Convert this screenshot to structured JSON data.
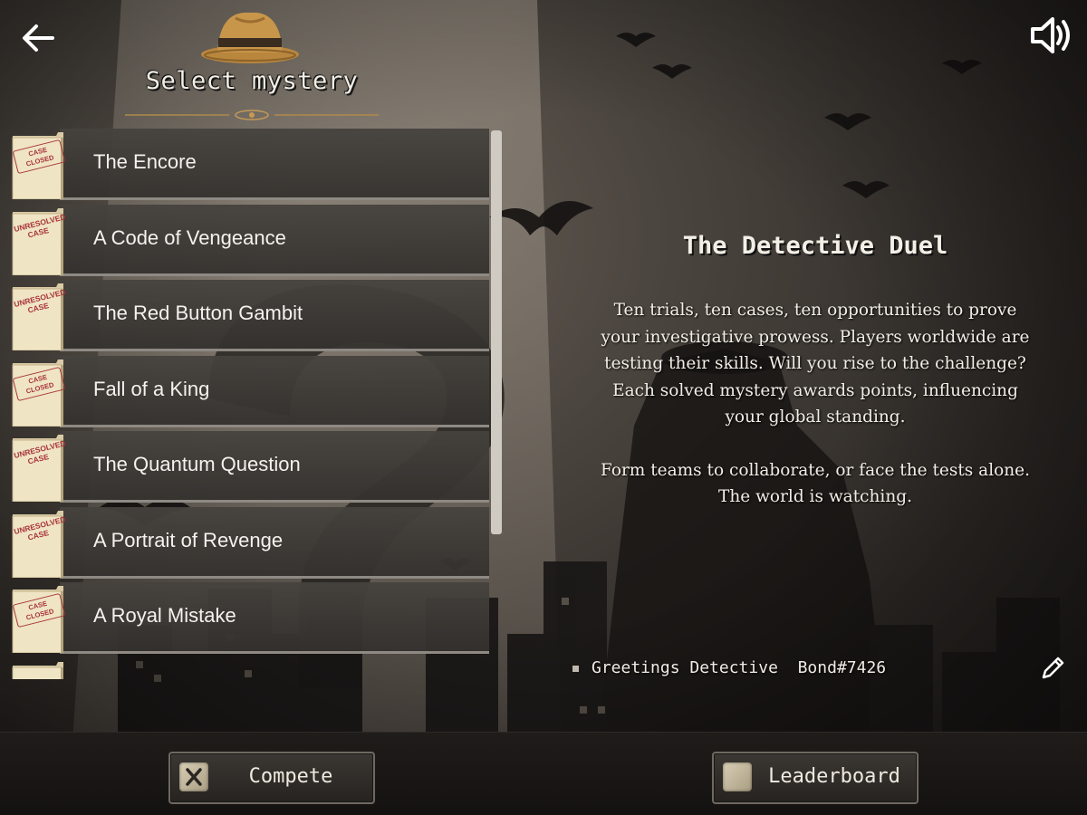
{
  "header": {
    "title": "Select mystery"
  },
  "mysteries": [
    {
      "title": "The Encore",
      "status": "CASE CLOSED",
      "status_type": "closed"
    },
    {
      "title": "A Code of Vengeance",
      "status": "UNRESOLVED CASE",
      "status_type": "unresolved"
    },
    {
      "title": "The Red Button Gambit",
      "status": "UNRESOLVED CASE",
      "status_type": "unresolved"
    },
    {
      "title": "Fall of a King",
      "status": "CASE CLOSED",
      "status_type": "closed"
    },
    {
      "title": "The Quantum Question",
      "status": "UNRESOLVED CASE",
      "status_type": "unresolved"
    },
    {
      "title": "A Portrait of Revenge",
      "status": "UNRESOLVED CASE",
      "status_type": "unresolved"
    },
    {
      "title": "A Royal Mistake",
      "status": "CASE CLOSED",
      "status_type": "closed"
    }
  ],
  "panel": {
    "title": "The Detective Duel",
    "paragraph1": "Ten trials, ten cases, ten opportunities to prove your investigative prowess. Players worldwide are testing their skills. Will you rise to the challenge? Each solved mystery awards points, influencing your global standing.",
    "paragraph2": "Form teams to collaborate, or face the tests alone. The world is watching."
  },
  "greeting": {
    "prefix": "Greetings Detective",
    "name": "Bond#7426"
  },
  "buttons": {
    "compete": "Compete",
    "leaderboard": "Leaderboard"
  },
  "icons": {
    "back": "arrow-left-icon",
    "sound": "speaker-icon",
    "edit": "pencil-icon",
    "hat": "fedora-hat-icon",
    "compete": "x-icon",
    "leaderboard": "plaque-icon"
  },
  "colors": {
    "stamp_red": "#a8343a",
    "folder": "#efe4c4",
    "text": "#f3efe6"
  }
}
